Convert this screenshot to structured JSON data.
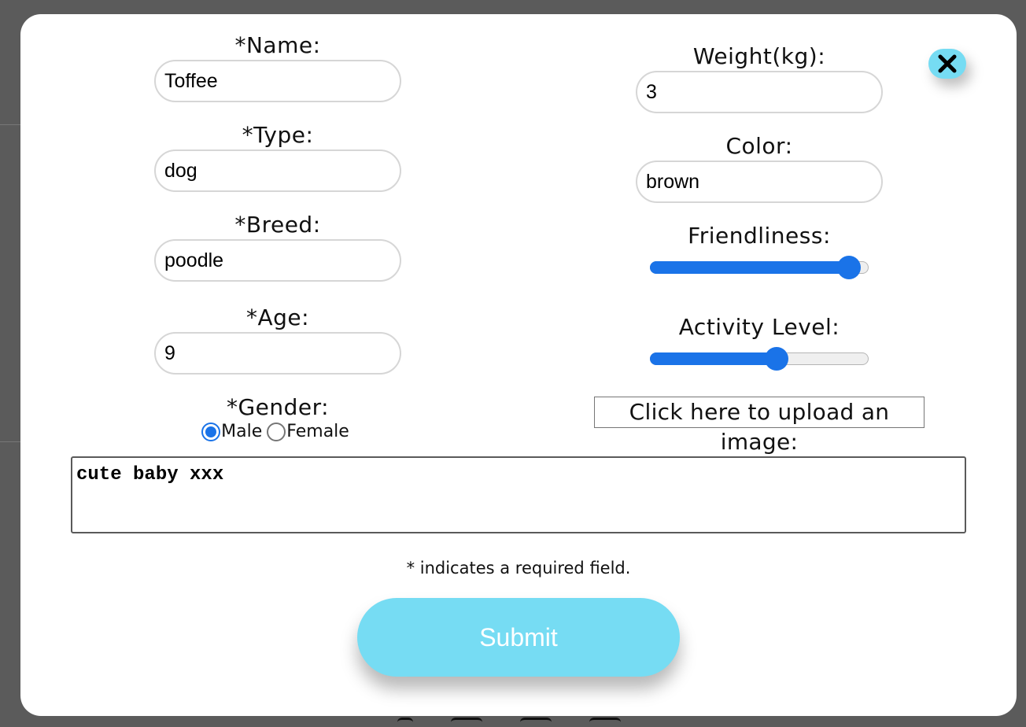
{
  "form": {
    "left": {
      "name": {
        "label": "*Name:",
        "value": "Toffee"
      },
      "type": {
        "label": "*Type:",
        "value": "dog"
      },
      "breed": {
        "label": "*Breed:",
        "value": "poodle"
      },
      "age": {
        "label": "*Age:",
        "value": "9"
      },
      "gender": {
        "label": "*Gender:",
        "options": [
          {
            "label": "Male",
            "checked": true
          },
          {
            "label": "Female",
            "checked": false
          }
        ]
      }
    },
    "right": {
      "weight": {
        "label": "Weight(kg):",
        "value": "3"
      },
      "color": {
        "label": "Color:",
        "value": "brown"
      },
      "friendliness": {
        "label": "Friendliness:",
        "level_fraction": 0.91
      },
      "activity": {
        "label": "Activity Level:",
        "level_fraction": 0.58
      },
      "upload_label": "Click here to upload an image:"
    },
    "description": "cute baby xxx",
    "required_note": "* indicates a required field.",
    "submit_label": "Submit",
    "close_icon": "close-x-icon"
  },
  "colors": {
    "accent_blue": "#1a73e8",
    "button_cyan": "#76dcf3",
    "overlay": "#5b5b5b"
  }
}
